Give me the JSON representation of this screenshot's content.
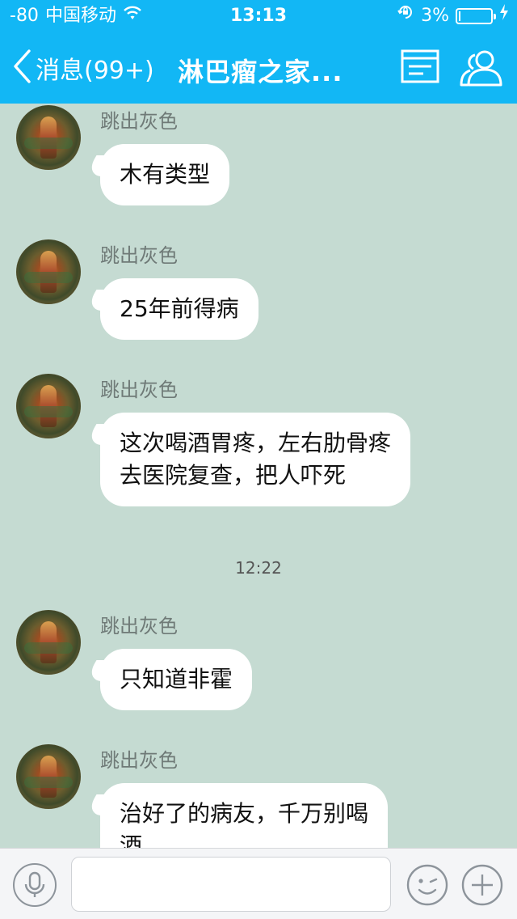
{
  "status_bar": {
    "signal": "-80",
    "carrier": "中国移动",
    "time": "13:13",
    "battery_percent": "3%",
    "battery_level": 0.03,
    "icons": [
      "wifi-icon",
      "rotation-lock-icon",
      "battery-icon",
      "charging-icon"
    ]
  },
  "nav": {
    "back_label": "消息(99+)",
    "title": "淋巴瘤之家...",
    "icons": [
      "chevron-left-icon",
      "menu-icon",
      "group-members-icon"
    ]
  },
  "chat": {
    "messages": [
      {
        "sender": "跳出灰色",
        "lines": [
          "木有类型"
        ]
      },
      {
        "sender": "跳出灰色",
        "lines": [
          "25年前得病"
        ]
      },
      {
        "sender": "跳出灰色",
        "lines": [
          "这次喝酒胃疼，左右肋骨疼",
          "去医院复查，把人吓死"
        ]
      },
      {
        "sender": "跳出灰色",
        "lines": [
          "只知道非霍"
        ]
      },
      {
        "sender": "跳出灰色",
        "lines": [
          "治好了的病友，千万别喝",
          "酒。"
        ]
      }
    ],
    "timestamp": "12:22"
  },
  "input_bar": {
    "text_value": "",
    "icons": [
      "microphone-icon",
      "emoji-icon",
      "plus-icon"
    ]
  },
  "colors": {
    "accent": "#12b7f5",
    "chat_background": "#c5dbd2",
    "bubble": "#ffffff"
  }
}
